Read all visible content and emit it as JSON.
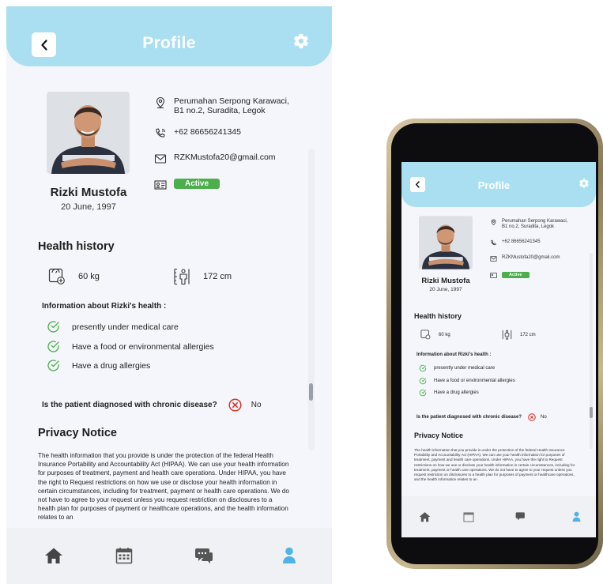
{
  "header": {
    "title": "Profile"
  },
  "profile": {
    "name": "Rizki Mustofa",
    "dob": "20 June, 1997",
    "address_line1": "Perumahan Serpong Karawaci,",
    "address_line2": "B1 no.2, Suradita, Legok",
    "phone": "+62 86656241345",
    "email": "RZKMustofa20@gmail.com",
    "status": "Active"
  },
  "health": {
    "title": "Health history",
    "weight": "60 kg",
    "height": "172 cm",
    "info_label": "Information about Rizki's health :",
    "items": [
      "presently under medical care",
      "Have a food or environmental allergies",
      "Have a drug allergies"
    ],
    "chronic_question": "Is the patient diagnosed with chronic disease?",
    "chronic_answer": "No"
  },
  "privacy": {
    "title": "Privacy Notice",
    "text": "The health information that you provide is under the protection of the federal Health Insurance Portability and Accountability Act (HIPAA). We can use your health information for purposes of treatment, payment and health care operations. Under HIPAA, you have the right to Request restrictions on how we use or disclose your health information in certain circumstances, including for treatment, payment or health care operations. We do not have to agree to your request unless you request restriction on disclosures to a health plan for purposes of payment or healthcare operations, and the health information relates to an"
  },
  "nav": {
    "items": [
      "home-icon",
      "calendar-icon",
      "chat-icon",
      "profile-icon"
    ],
    "active": "profile-icon"
  },
  "colors": {
    "header": "#a9dff0",
    "active_badge": "#4cae4c",
    "check": "#4cae4c",
    "no_mark": "#d9342b",
    "nav_icon": "#444444",
    "nav_active": "#4fb3e8"
  }
}
